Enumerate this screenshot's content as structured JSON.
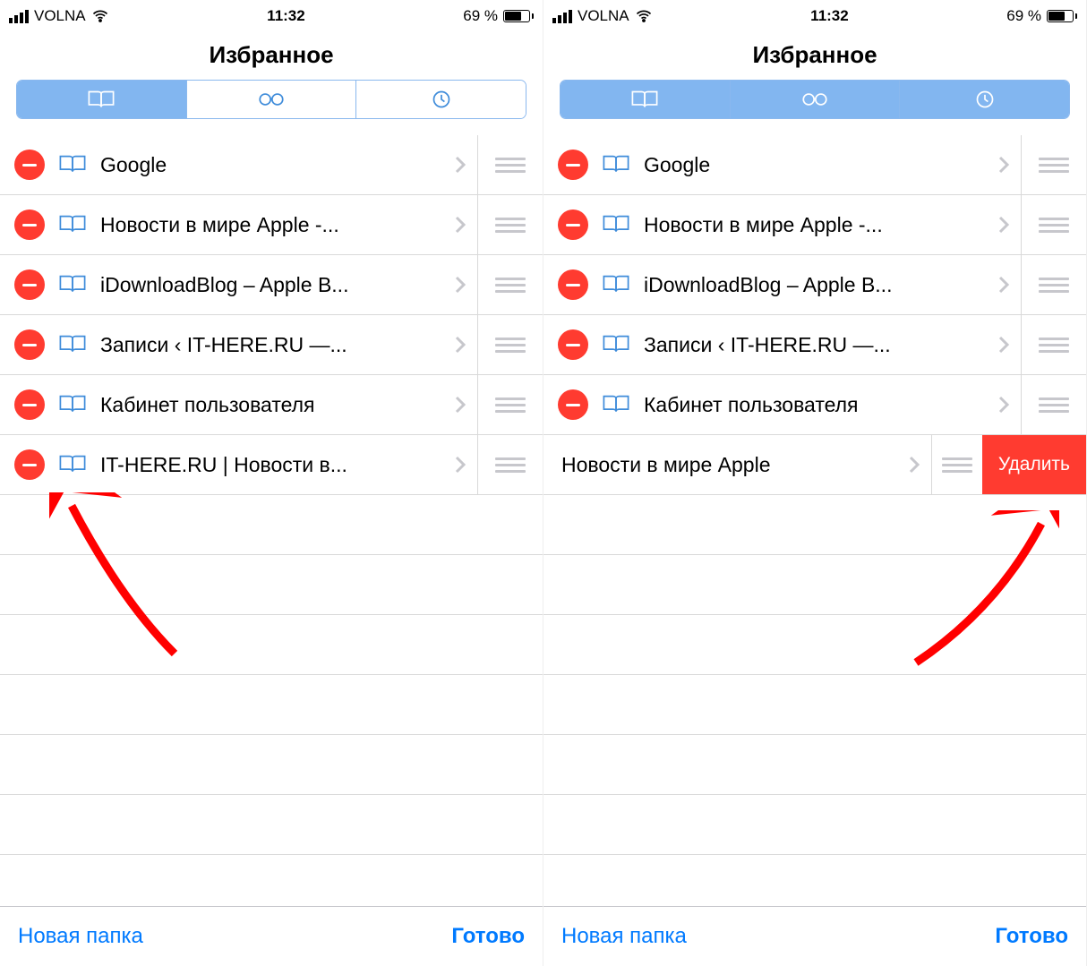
{
  "status": {
    "carrier": "VOLNA",
    "time": "11:32",
    "battery_pct": "69 %"
  },
  "header": {
    "title": "Избранное"
  },
  "toolbar": {
    "new_folder": "Новая папка",
    "done": "Готово"
  },
  "delete_label": "Удалить",
  "left": {
    "items": [
      {
        "label": "Google"
      },
      {
        "label": "Новости в мире Apple -..."
      },
      {
        "label": "iDownloadBlog – Apple B..."
      },
      {
        "label": "Записи ‹ IT-HERE.RU —..."
      },
      {
        "label": "Кабинет пользователя"
      },
      {
        "label": "IT-HERE.RU | Новости в..."
      }
    ]
  },
  "right": {
    "items": [
      {
        "label": "Google"
      },
      {
        "label": "Новости в мире Apple -..."
      },
      {
        "label": "iDownloadBlog – Apple B..."
      },
      {
        "label": "Записи ‹ IT-HERE.RU —..."
      },
      {
        "label": "Кабинет пользователя"
      }
    ],
    "swiped": {
      "label": "Новости в мире Apple"
    }
  }
}
